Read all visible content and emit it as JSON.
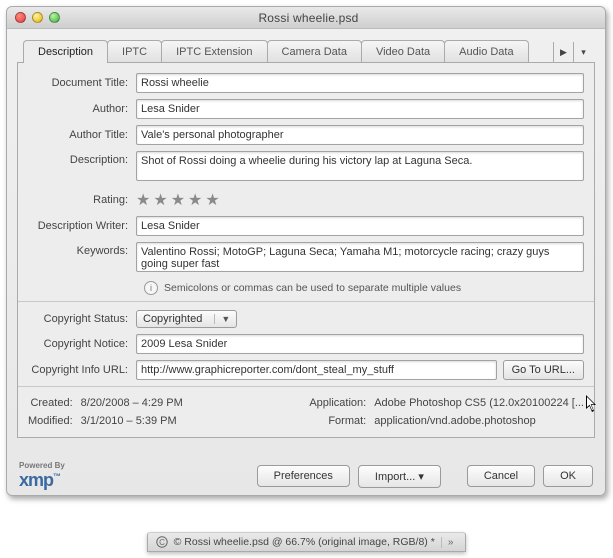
{
  "window_title": "Rossi wheelie.psd",
  "tabs": [
    {
      "label": "Description"
    },
    {
      "label": "IPTC"
    },
    {
      "label": "IPTC Extension"
    },
    {
      "label": "Camera Data"
    },
    {
      "label": "Video Data"
    },
    {
      "label": "Audio Data"
    }
  ],
  "labels": {
    "doc_title": "Document Title:",
    "author": "Author:",
    "author_title": "Author Title:",
    "description": "Description:",
    "rating": "Rating:",
    "desc_writer": "Description Writer:",
    "keywords": "Keywords:",
    "copyright_status": "Copyright Status:",
    "copyright_notice": "Copyright Notice:",
    "copyright_url": "Copyright Info URL:",
    "created": "Created:",
    "modified": "Modified:",
    "application": "Application:",
    "format": "Format:"
  },
  "values": {
    "doc_title": "Rossi wheelie",
    "author": "Lesa Snider",
    "author_title": "Vale's personal photographer",
    "description": "Shot of Rossi doing a wheelie during his victory lap at Laguna Seca.",
    "desc_writer": "Lesa Snider",
    "keywords": "Valentino Rossi; MotoGP; Laguna Seca; Yamaha M1; motorcycle racing; crazy guys going super fast",
    "copyright_status": "Copyrighted",
    "copyright_notice": "2009 Lesa Snider",
    "copyright_url": "http://www.graphicreporter.com/dont_steal_my_stuff",
    "created": "8/20/2008 – 4:29 PM",
    "modified": "3/1/2010 – 5:39 PM",
    "application": "Adobe Photoshop CS5 (12.0x20100224 [...",
    "format": "application/vnd.adobe.photoshop"
  },
  "hint": "Semicolons or commas can be used to separate multiple values",
  "buttons": {
    "go_to_url": "Go To URL...",
    "preferences": "Preferences",
    "import": "Import...",
    "cancel": "Cancel",
    "ok": "OK"
  },
  "powered_by": "Powered By",
  "xmp": "xmp",
  "status_tab": "© Rossi wheelie.psd @ 66.7% (original image, RGB/8) *"
}
